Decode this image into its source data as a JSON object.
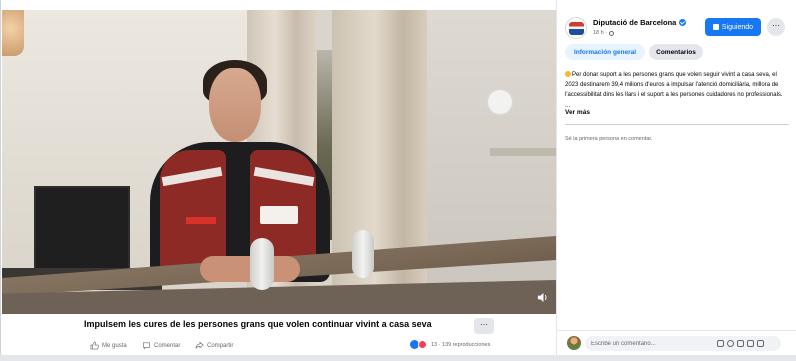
{
  "video": {
    "title": "Impulsem les cures de les persones grans que volen continuar vivint a casa seva",
    "more_label": "···",
    "volume_icon": "volume-icon"
  },
  "actions": {
    "like_label": "Me gusta",
    "comment_label": "Comentar",
    "share_label": "Compartir",
    "reactions_text": "13 · 139 reproducciones"
  },
  "post": {
    "page_name": "Diputació de Barcelona",
    "time": "18 h ·",
    "follow_label": "Siguiendo",
    "more_label": "···",
    "tabs": [
      {
        "label": "Información general",
        "active": true
      },
      {
        "label": "Comentarios",
        "active": false
      }
    ],
    "text": "Per donar suport a les persones grans que volen seguir vivint a casa seva, el 2023 destinarem 39,4 milions d'euros a impulsar l'atenció domiciliària, millora de l'accessibilitat dins les llars i el suport a les persones cuidadores no professionals. ...",
    "see_more": "Ver más",
    "no_comments": "Sé la primera persona en comentar."
  },
  "comment_box": {
    "placeholder": "Escribe un comentario..."
  },
  "colors": {
    "accent": "#1877f2",
    "secondary_bg": "#e4e6eb",
    "muted_text": "#65676b"
  }
}
